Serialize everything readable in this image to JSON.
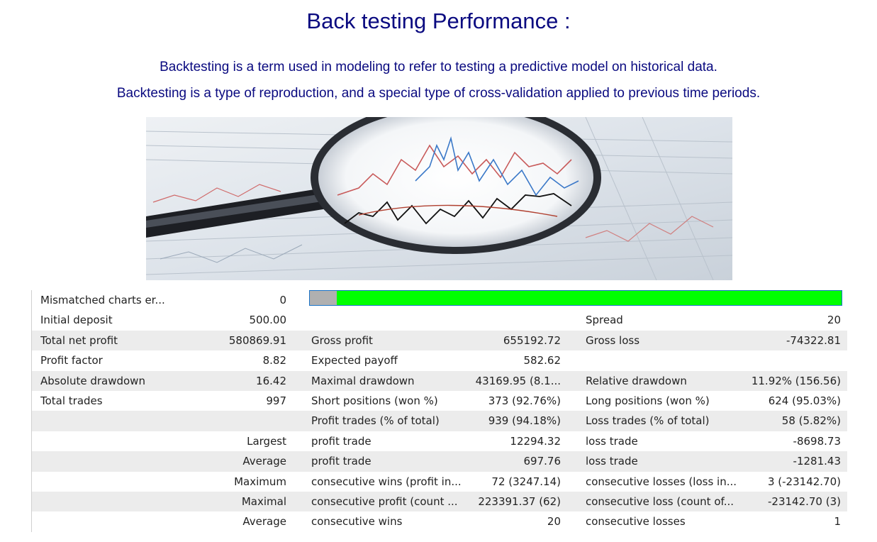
{
  "title": "Back testing Performance :",
  "description": [
    "Backtesting is a term used in modeling to refer to testing a predictive model on historical data.",
    "Backtesting is a type of reproduction, and a special type of cross-validation applied to previous time periods."
  ],
  "progress": {
    "fraction": 0.05,
    "fill_color": "#00ff00",
    "empty_color": "#b0b0b0"
  },
  "report": {
    "rows": [
      [
        "Mismatched charts er...",
        "0",
        "",
        "",
        "",
        ""
      ],
      [
        "Initial deposit",
        "500.00",
        "",
        "",
        "Spread",
        "20"
      ],
      [
        "Total net profit",
        "580869.91",
        "Gross profit",
        "655192.72",
        "Gross loss",
        "-74322.81"
      ],
      [
        "Profit factor",
        "8.82",
        "Expected payoff",
        "582.62",
        "",
        ""
      ],
      [
        "Absolute drawdown",
        "16.42",
        "Maximal drawdown",
        "43169.95 (8.1...",
        "Relative drawdown",
        "11.92% (156.56)"
      ],
      [
        "Total trades",
        "997",
        "Short positions (won %)",
        "373 (92.76%)",
        "Long positions (won %)",
        "624 (95.03%)"
      ],
      [
        "",
        "",
        "Profit trades (% of total)",
        "939 (94.18%)",
        "Loss trades (% of total)",
        "58 (5.82%)"
      ],
      [
        "",
        "Largest",
        "profit trade",
        "12294.32",
        "loss trade",
        "-8698.73"
      ],
      [
        "",
        "Average",
        "profit trade",
        "697.76",
        "loss trade",
        "-1281.43"
      ],
      [
        "",
        "Maximum",
        "consecutive wins (profit in...",
        "72 (3247.14)",
        "consecutive losses (loss in...",
        "3 (-23142.70)"
      ],
      [
        "",
        "Maximal",
        "consecutive profit (count ...",
        "223391.37 (62)",
        "consecutive loss (count of...",
        "-23142.70 (3)"
      ],
      [
        "",
        "Average",
        "consecutive wins",
        "20",
        "consecutive losses",
        "1"
      ]
    ]
  }
}
